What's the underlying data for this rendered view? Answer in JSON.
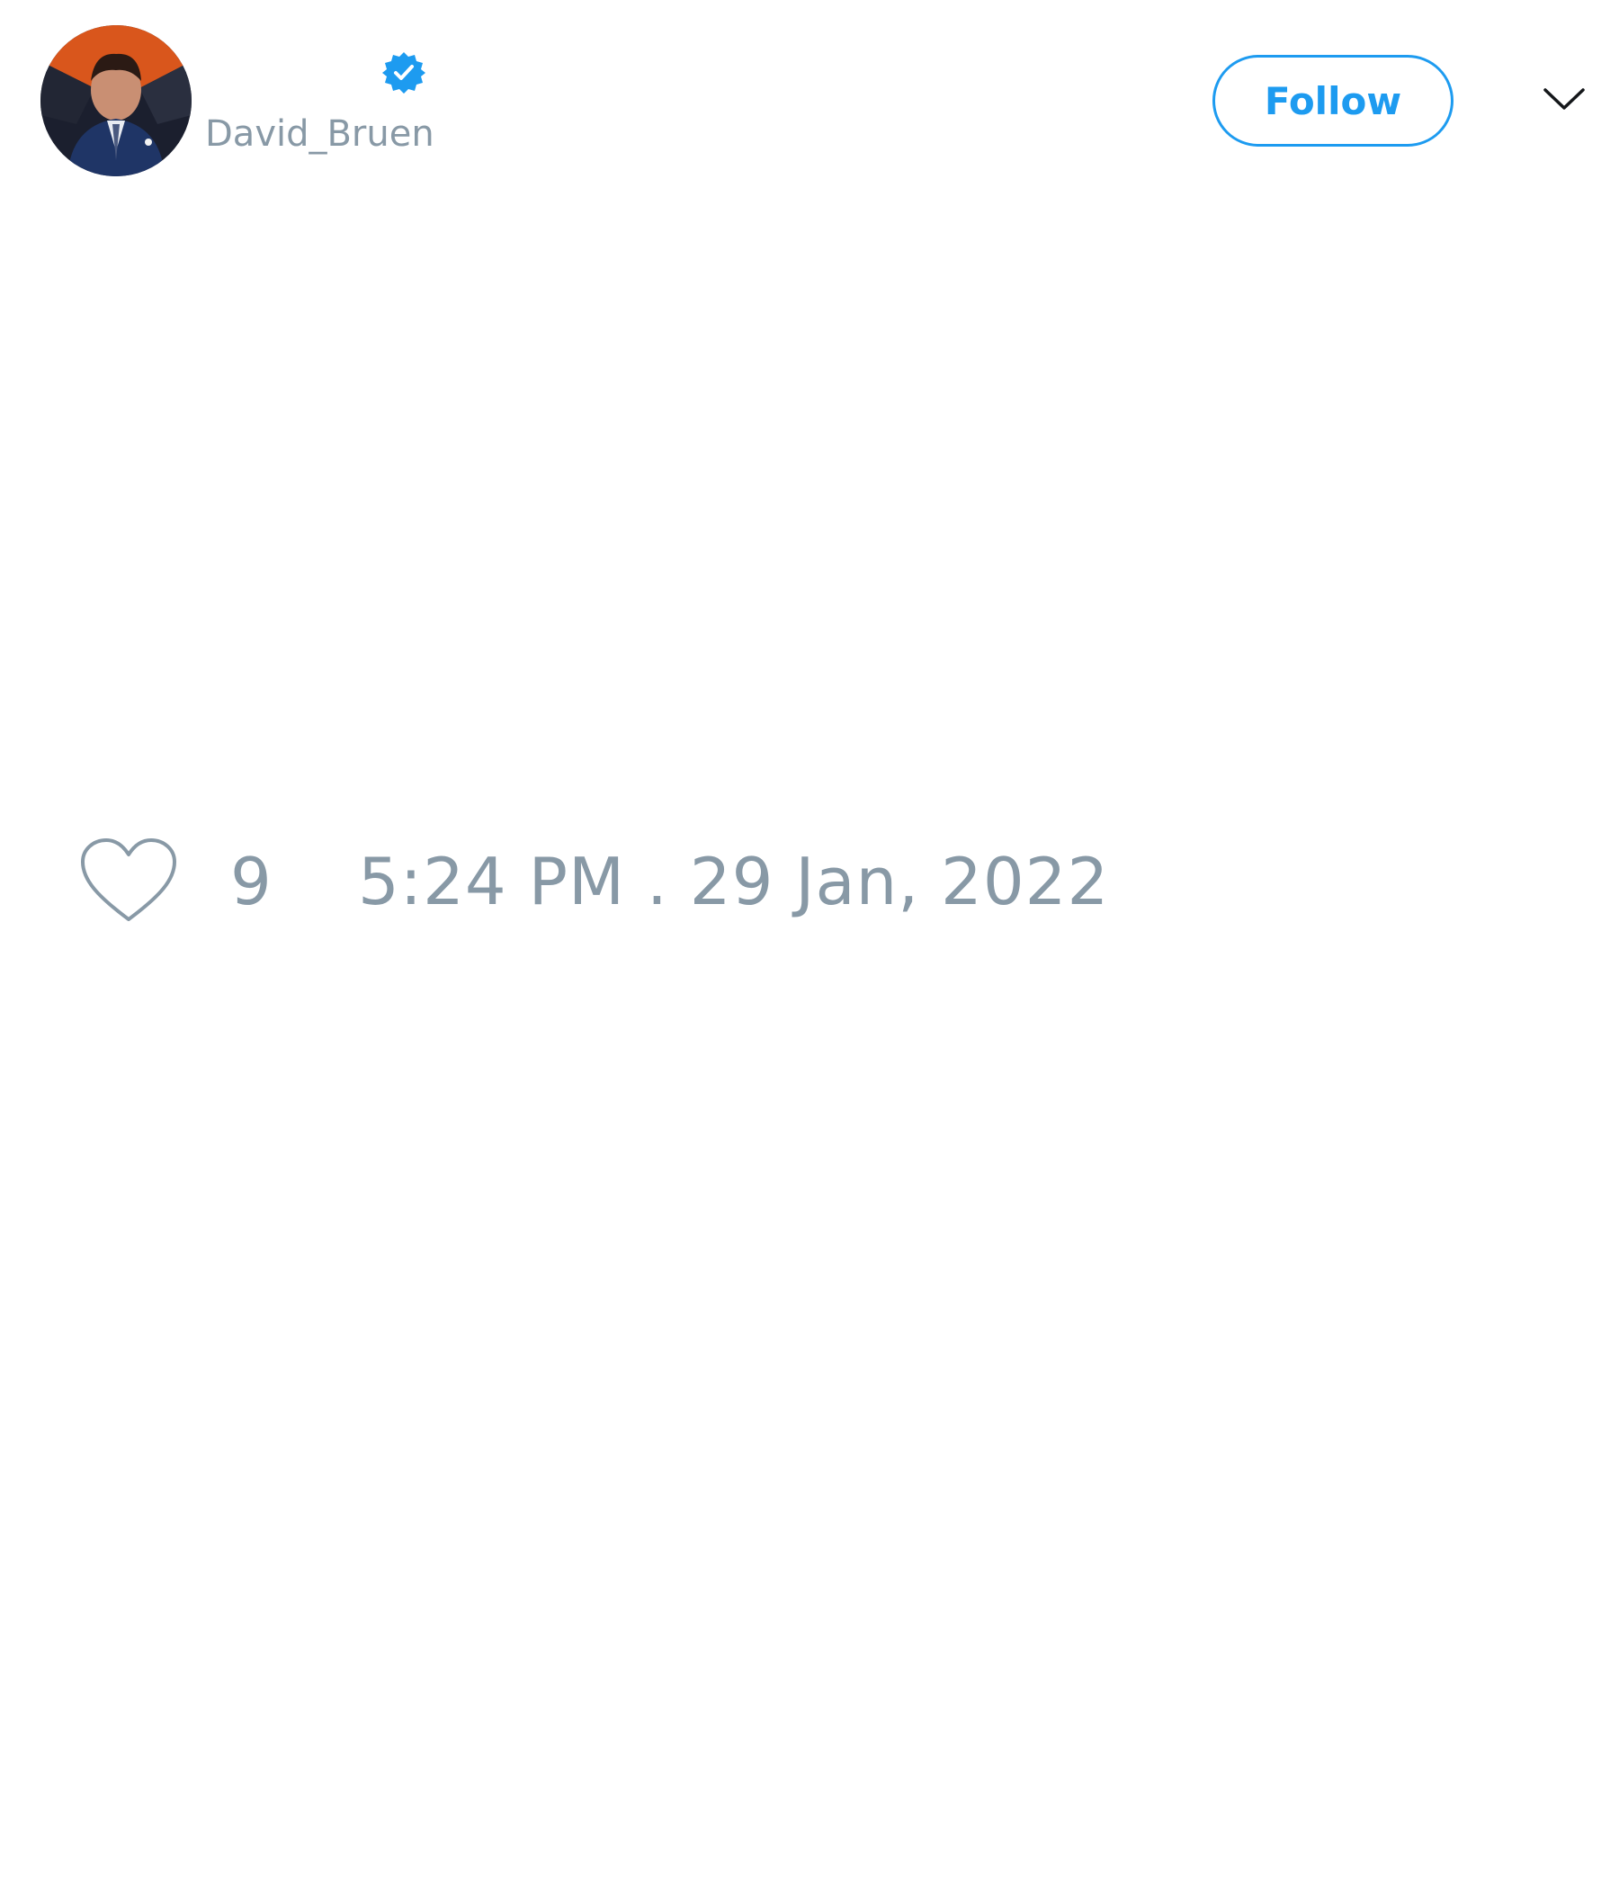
{
  "tweet": {
    "author": {
      "display_name": "",
      "handle": "David_Bruen",
      "verified": true,
      "avatar_icon": "profile-photo"
    },
    "follow_label": "Follow",
    "menu_icon": "chevron-down-icon",
    "like_icon": "heart-outline-icon",
    "like_count": "9",
    "timestamp": "5:24 PM . 29 Jan, 2022"
  },
  "colors": {
    "accent": "#1d9bf0",
    "muted": "#8899a6",
    "text": "#14171a",
    "background": "#ffffff"
  }
}
